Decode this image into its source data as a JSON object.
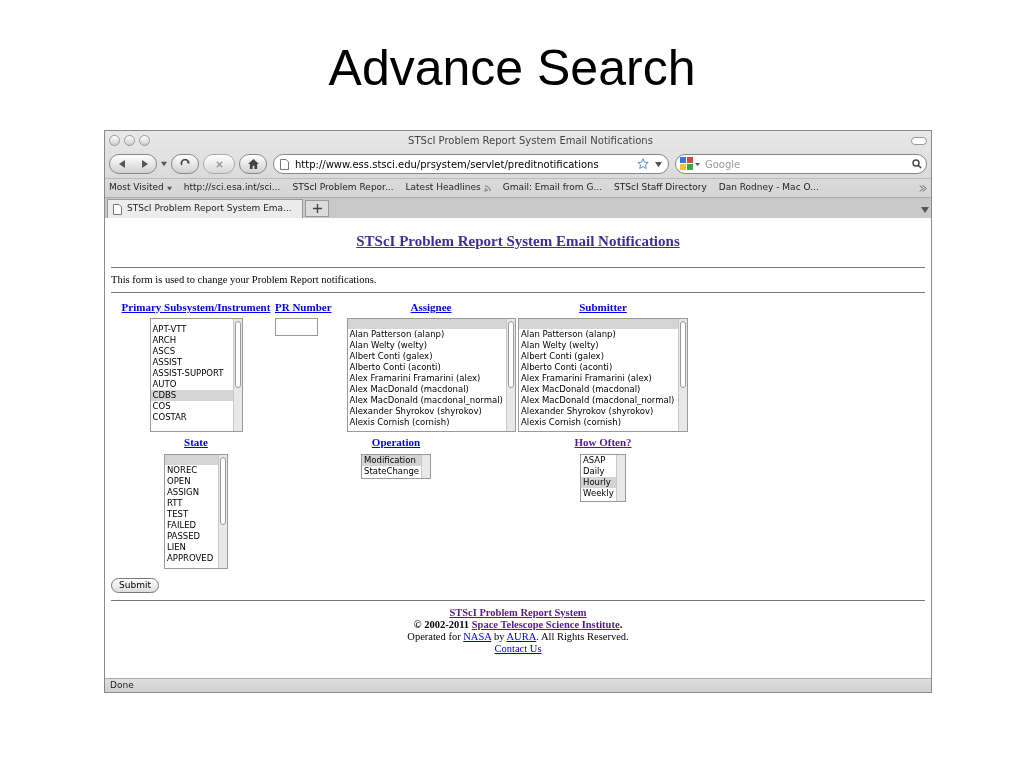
{
  "slide": {
    "title": "Advance Search"
  },
  "browser": {
    "window_title": "STScI Problem Report System Email Notifications",
    "url": "http://www.ess.stsci.edu/prsystem/servlet/preditnotifications",
    "search_placeholder": "Google",
    "bookmarks": [
      {
        "label": "Most Visited",
        "kind": "menu"
      },
      {
        "label": "http://sci.esa.int/sci...",
        "kind": "link"
      },
      {
        "label": "STScI Problem Repor...",
        "kind": "link"
      },
      {
        "label": "Latest Headlines",
        "kind": "feed"
      },
      {
        "label": "Gmail: Email from G...",
        "kind": "link"
      },
      {
        "label": "STScI Staff Directory",
        "kind": "link"
      },
      {
        "label": "Dan Rodney - Mac O...",
        "kind": "link"
      }
    ],
    "tabs": [
      {
        "label": "STScI Problem Report System Ema...",
        "selected": true
      }
    ],
    "status": "Done"
  },
  "page": {
    "heading": "STScI Problem Report System Email Notifications",
    "intro": "This form is used to change your Problem Report notifications.",
    "primary": {
      "label": "Primary Subsystem/Instrument",
      "items": [
        {
          "text": "APT-VTT",
          "selected": false
        },
        {
          "text": "ARCH",
          "selected": false
        },
        {
          "text": "ASCS",
          "selected": false
        },
        {
          "text": "ASSIST",
          "selected": false
        },
        {
          "text": "ASSIST-SUPPORT",
          "selected": false
        },
        {
          "text": "AUTO",
          "selected": false
        },
        {
          "text": "CDBS",
          "selected": true
        },
        {
          "text": "COS",
          "selected": false
        },
        {
          "text": "COSTAR",
          "selected": false
        }
      ]
    },
    "pr_number": {
      "label": "PR Number"
    },
    "assignee": {
      "label": "Assignee",
      "blank_selected": true,
      "items": [
        {
          "text": "Alan Patterson (alanp)",
          "selected": false
        },
        {
          "text": "Alan Welty (welty)",
          "selected": false
        },
        {
          "text": "Albert Conti (galex)",
          "selected": false
        },
        {
          "text": "Alberto Conti (aconti)",
          "selected": false
        },
        {
          "text": "Alex Framarini Framarini (alex)",
          "selected": false
        },
        {
          "text": "Alex MacDonald (macdonal)",
          "selected": false
        },
        {
          "text": "Alex MacDonald (macdonal_normal)",
          "selected": false
        },
        {
          "text": "Alexander Shyrokov (shyrokov)",
          "selected": false
        },
        {
          "text": "Alexis Cornish (cornish)",
          "selected": false
        }
      ]
    },
    "submitter": {
      "label": "Submitter",
      "blank_selected": true,
      "items": [
        {
          "text": "Alan Patterson (alanp)",
          "selected": false
        },
        {
          "text": "Alan Welty (welty)",
          "selected": false
        },
        {
          "text": "Albert Conti (galex)",
          "selected": false
        },
        {
          "text": "Alberto Conti (aconti)",
          "selected": false
        },
        {
          "text": "Alex Framarini Framarini (alex)",
          "selected": false
        },
        {
          "text": "Alex MacDonald (macdonal)",
          "selected": false
        },
        {
          "text": "Alex MacDonald (macdonal_normal)",
          "selected": false
        },
        {
          "text": "Alexander Shyrokov (shyrokov)",
          "selected": false
        },
        {
          "text": "Alexis Cornish (cornish)",
          "selected": false
        }
      ]
    },
    "state": {
      "label": "State",
      "blank_selected": true,
      "items": [
        {
          "text": "NOREC",
          "selected": false
        },
        {
          "text": "OPEN",
          "selected": false
        },
        {
          "text": "ASSIGN",
          "selected": false
        },
        {
          "text": "RTT",
          "selected": false
        },
        {
          "text": "TEST",
          "selected": false
        },
        {
          "text": "FAILED",
          "selected": false
        },
        {
          "text": "PASSED",
          "selected": false
        },
        {
          "text": "LIEN",
          "selected": false
        },
        {
          "text": "APPROVED",
          "selected": false
        }
      ]
    },
    "operation": {
      "label": "Operation",
      "items": [
        {
          "text": "Modification",
          "selected": true
        },
        {
          "text": "StateChange",
          "selected": false
        }
      ]
    },
    "how_often": {
      "label": "How Often?",
      "visited": true,
      "items": [
        {
          "text": "ASAP",
          "selected": false
        },
        {
          "text": "Daily",
          "selected": false
        },
        {
          "text": "Hourly",
          "selected": true
        },
        {
          "text": "Weekly",
          "selected": false
        }
      ]
    },
    "submit": "Submit",
    "footer": {
      "system_link": "STScI Problem Report System",
      "copyright": {
        "prefix": "© 2002-2011 ",
        "link": "Space Telescope Science Institute",
        "suffix": "."
      },
      "operated": {
        "prefix": "Operated for ",
        "link1": "NASA",
        "middle": " by ",
        "link2": "AURA",
        "suffix": ". All Rights Reserved."
      },
      "contact": "Contact Us"
    }
  }
}
